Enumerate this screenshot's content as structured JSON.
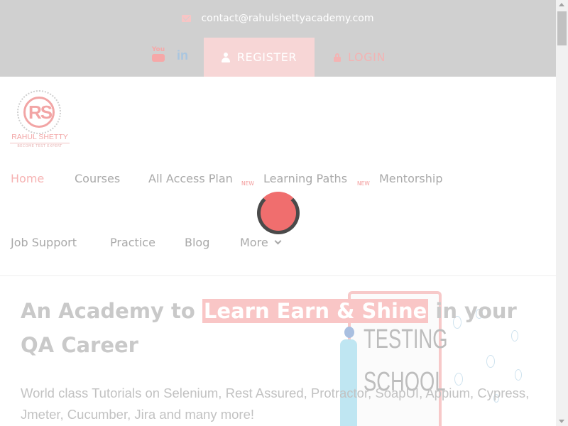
{
  "topbar": {
    "email": "contact@rahulshettyacademy.com",
    "register_label": "REGISTER",
    "login_label": "LOGIN",
    "youtube_label": "You",
    "linkedin_label": "in"
  },
  "logo": {
    "mark": "RS",
    "name": "RAHUL SHETTY",
    "tagline": "BECOME TEST EXPERT"
  },
  "nav": {
    "items": [
      {
        "label": "Home"
      },
      {
        "label": "Courses"
      },
      {
        "label": "All Access Plan",
        "badge": "NEW"
      },
      {
        "label": "Learning Paths",
        "badge": "NEW"
      },
      {
        "label": "Mentorship"
      },
      {
        "label": "Job Support"
      },
      {
        "label": "Practice"
      },
      {
        "label": "Blog"
      },
      {
        "label": "More"
      }
    ]
  },
  "hero": {
    "title_part1": "An Academy to ",
    "title_highlight": "Learn Earn & Shine",
    "title_part2": " in your QA Career",
    "subtitle": "World class Tutorials on Selenium, Rest Assured, Protractor, SoapUI, Appium, Cypress, Jmeter, Cucumber, Jira and many more!",
    "illustration_line1": "TESTING",
    "illustration_line2": "SCHOOL"
  },
  "colors": {
    "accent": "#f06e6e",
    "topbar_bg": "#d0d0d0",
    "register_bg": "#f7d6d6"
  }
}
